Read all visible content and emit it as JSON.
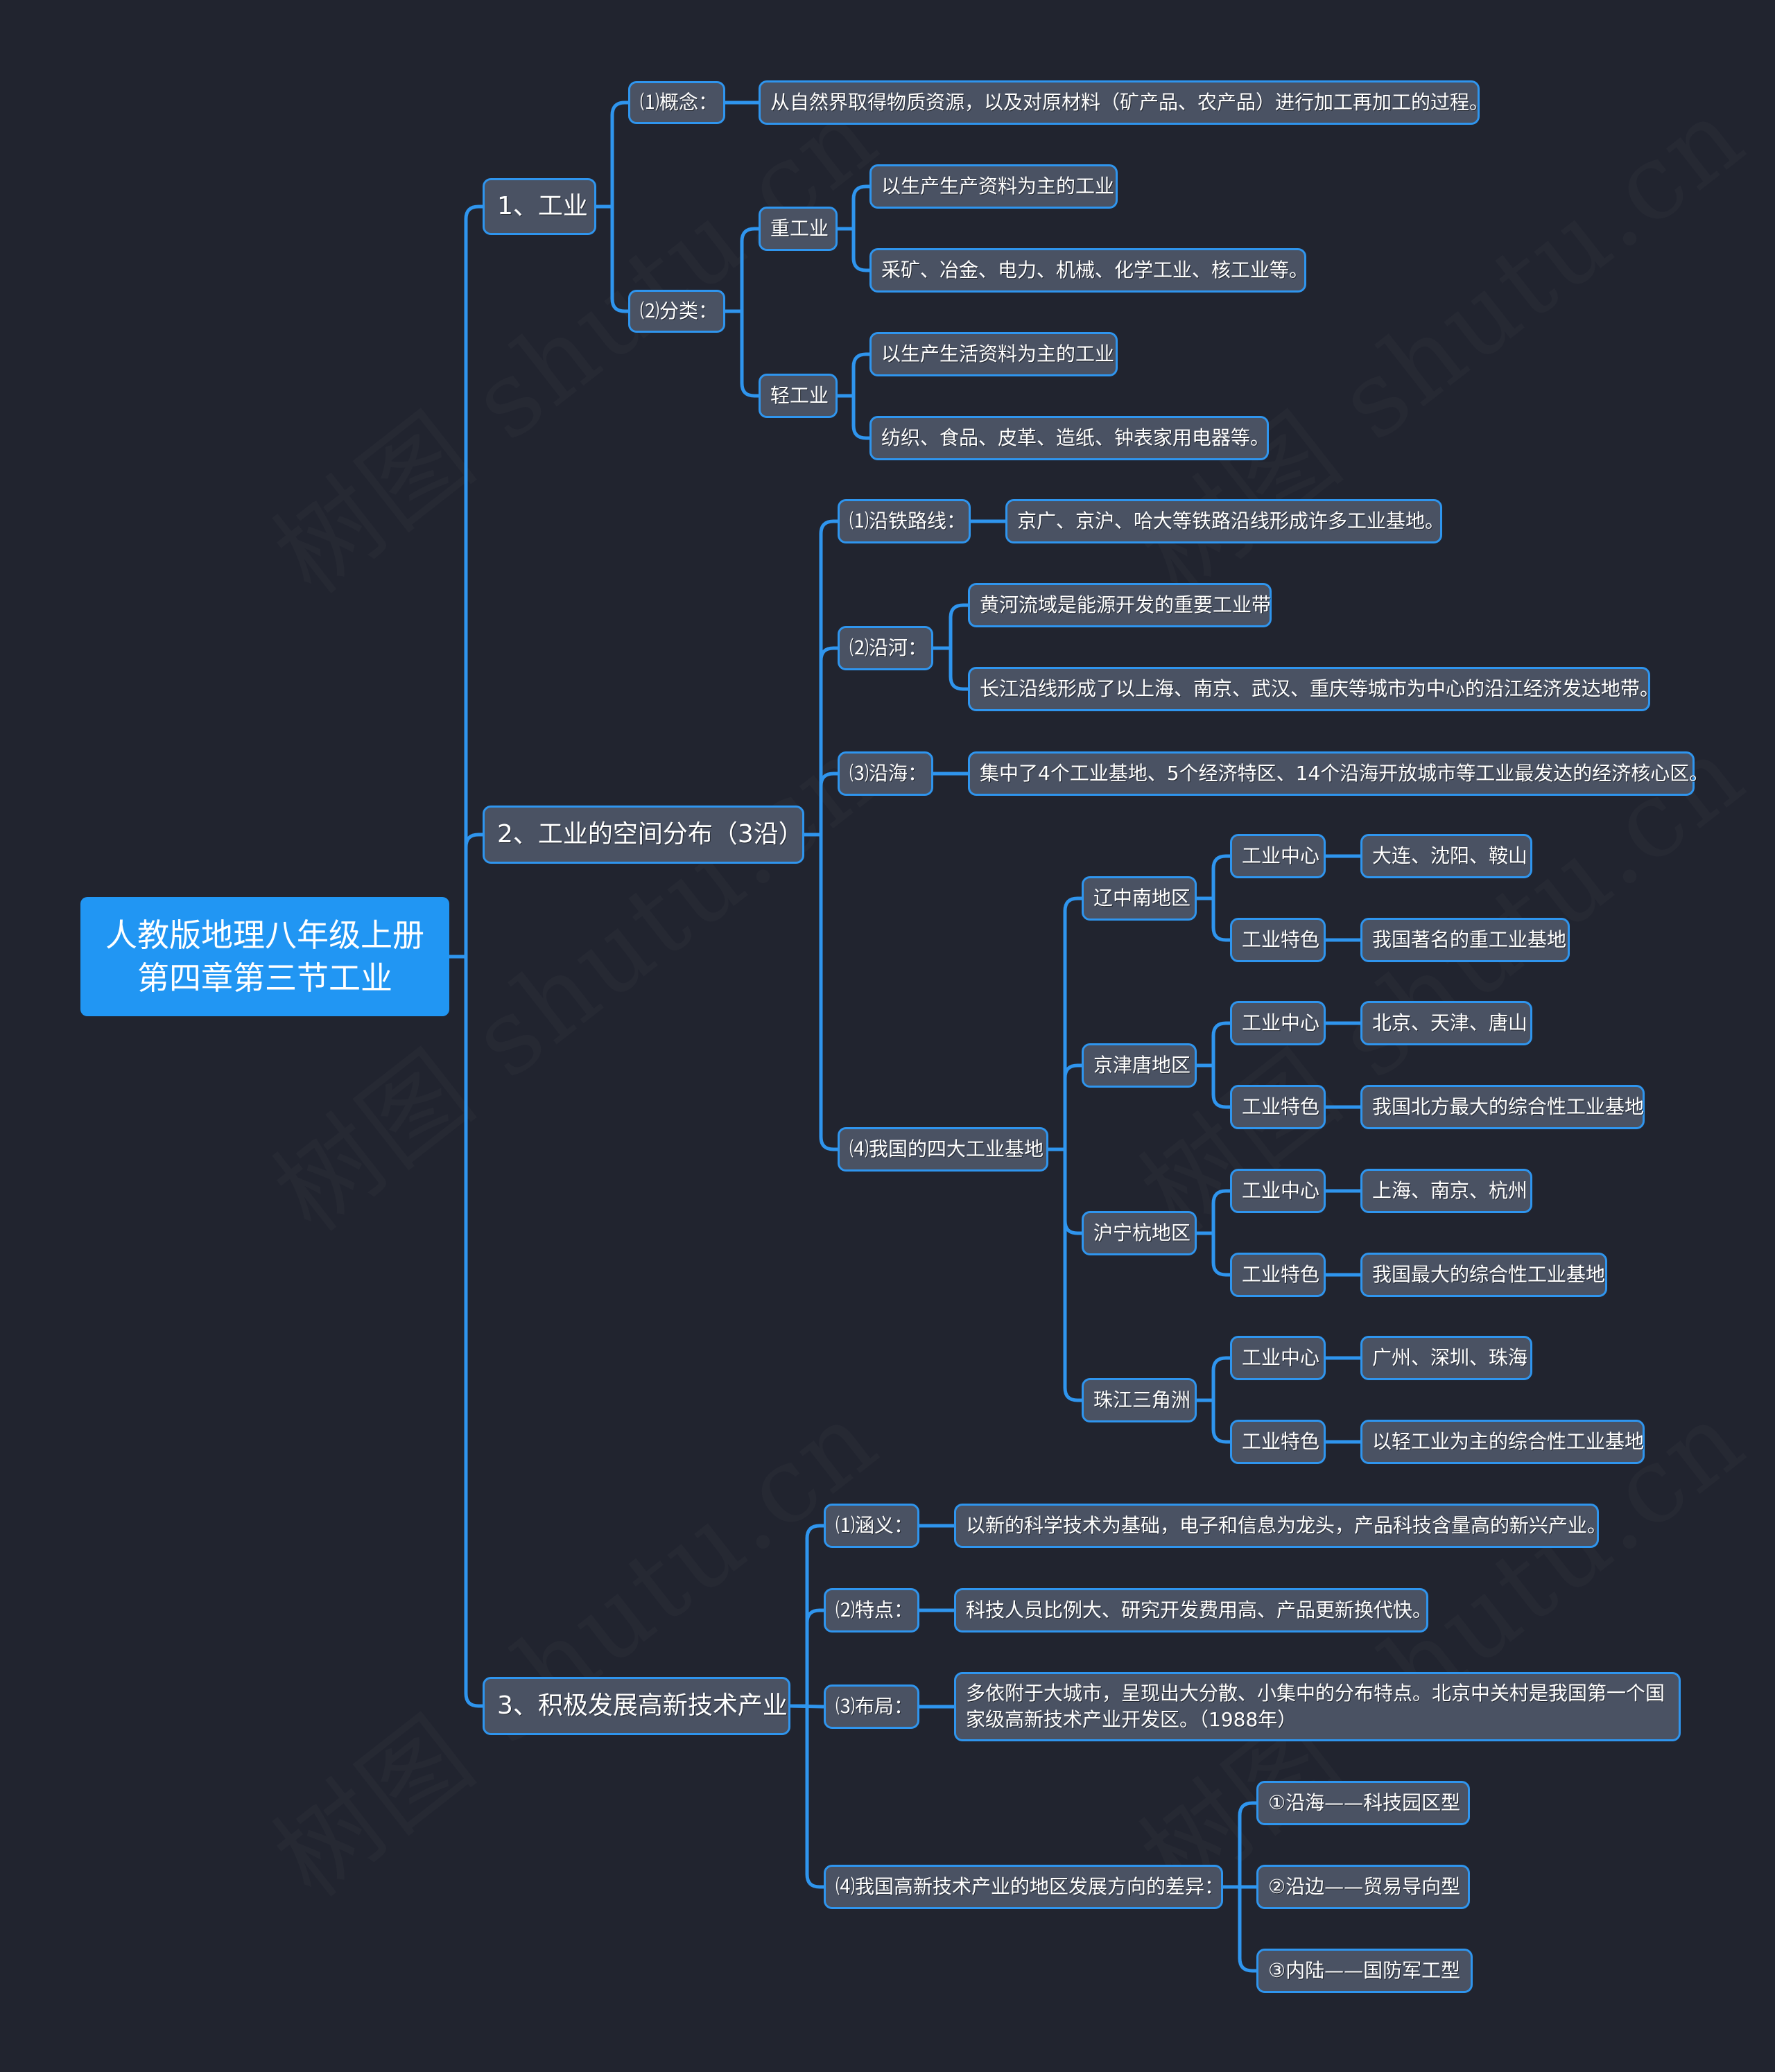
{
  "mindmap": {
    "root": "人教版地理八年级上册第四章第三节工业",
    "colors": {
      "background": "#21242f",
      "root_fill": "#2196f3",
      "node_fill": "#4a5263",
      "node_border": "#2f95ee",
      "connector": "#2f95ee",
      "text": "#ffffff"
    },
    "watermark": "树图 shutu.cn",
    "branches": [
      {
        "label": "1、工业",
        "children": [
          {
            "label": "⑴概念：",
            "children": [
              {
                "label": "从自然界取得物质资源，以及对原材料（矿产品、农产品）进行加工再加工的过程。"
              }
            ]
          },
          {
            "label": "⑵分类：",
            "children": [
              {
                "label": "重工业",
                "children": [
                  {
                    "label": "以生产生产资料为主的工业"
                  },
                  {
                    "label": "采矿、冶金、电力、机械、化学工业、核工业等。"
                  }
                ]
              },
              {
                "label": "轻工业",
                "children": [
                  {
                    "label": "以生产生活资料为主的工业"
                  },
                  {
                    "label": "纺织、食品、皮革、造纸、钟表家用电器等。"
                  }
                ]
              }
            ]
          }
        ]
      },
      {
        "label": "2、工业的空间分布（3沿）",
        "children": [
          {
            "label": "⑴沿铁路线：",
            "children": [
              {
                "label": "京广、京沪、哈大等铁路沿线形成许多工业基地。"
              }
            ]
          },
          {
            "label": "⑵沿河：",
            "children": [
              {
                "label": "黄河流域是能源开发的重要工业带"
              },
              {
                "label": "长江沿线形成了以上海、南京、武汉、重庆等城市为中心的沿江经济发达地带。"
              }
            ]
          },
          {
            "label": "⑶沿海：",
            "children": [
              {
                "label": "集中了4个工业基地、5个经济特区、14个沿海开放城市等工业最发达的经济核心区。"
              }
            ]
          },
          {
            "label": "⑷我国的四大工业基地",
            "children": [
              {
                "label": "辽中南地区",
                "children": [
                  {
                    "label": "工业中心",
                    "children": [
                      {
                        "label": "大连、沈阳、鞍山"
                      }
                    ]
                  },
                  {
                    "label": "工业特色",
                    "children": [
                      {
                        "label": "我国著名的重工业基地"
                      }
                    ]
                  }
                ]
              },
              {
                "label": "京津唐地区",
                "children": [
                  {
                    "label": "工业中心",
                    "children": [
                      {
                        "label": "北京、天津、唐山"
                      }
                    ]
                  },
                  {
                    "label": "工业特色",
                    "children": [
                      {
                        "label": "我国北方最大的综合性工业基地"
                      }
                    ]
                  }
                ]
              },
              {
                "label": "沪宁杭地区",
                "children": [
                  {
                    "label": "工业中心",
                    "children": [
                      {
                        "label": "上海、南京、杭州"
                      }
                    ]
                  },
                  {
                    "label": "工业特色",
                    "children": [
                      {
                        "label": "我国最大的综合性工业基地"
                      }
                    ]
                  }
                ]
              },
              {
                "label": "珠江三角洲",
                "children": [
                  {
                    "label": "工业中心",
                    "children": [
                      {
                        "label": "广州、深圳、珠海"
                      }
                    ]
                  },
                  {
                    "label": "工业特色",
                    "children": [
                      {
                        "label": "以轻工业为主的综合性工业基地"
                      }
                    ]
                  }
                ]
              }
            ]
          }
        ]
      },
      {
        "label": "3、积极发展高新技术产业",
        "children": [
          {
            "label": "⑴涵义：",
            "children": [
              {
                "label": "以新的科学技术为基础，电子和信息为龙头，产品科技含量高的新兴产业。"
              }
            ]
          },
          {
            "label": "⑵特点：",
            "children": [
              {
                "label": "科技人员比例大、研究开发费用高、产品更新换代快。"
              }
            ]
          },
          {
            "label": "⑶布局：",
            "children": [
              {
                "label": "多依附于大城市，呈现出大分散、小集中的分布特点。北京中关村是我国第一个国家级高新技术产业开发区。（1988年）"
              }
            ]
          },
          {
            "label": "⑷我国高新技术产业的地区发展方向的差异：",
            "children": [
              {
                "label": "①沿海——科技园区型"
              },
              {
                "label": "②沿边——贸易导向型"
              },
              {
                "label": "③内陆——国防军工型"
              }
            ]
          }
        ]
      }
    ]
  }
}
